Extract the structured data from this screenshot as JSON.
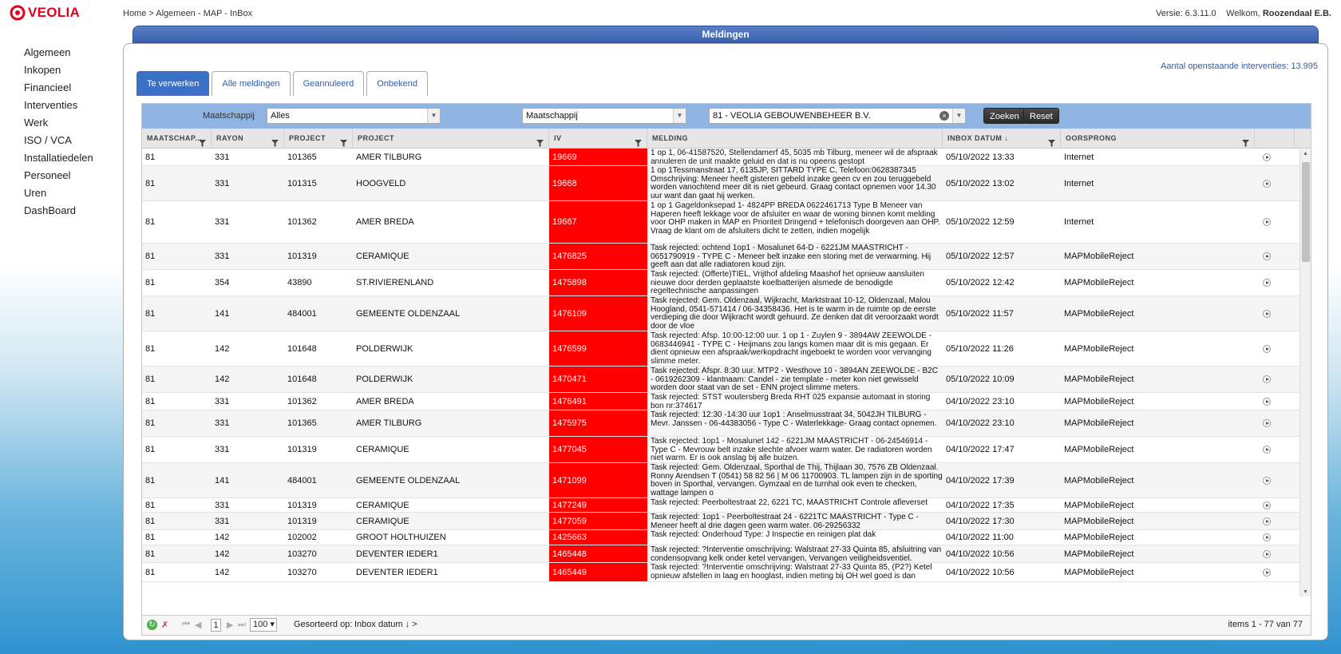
{
  "brand": {
    "name": "VEOLIA",
    "color": "#e2001a"
  },
  "breadcrumb": "Home > Algemeen - MAP - InBox",
  "version": "Versie: 6.3.11.0",
  "welcome": {
    "prefix": "Welkom,",
    "user": "Roozendaal E.B."
  },
  "sidebar": {
    "items": [
      "Algemeen",
      "Inkopen",
      "Financieel",
      "Interventies",
      "Werk",
      "ISO / VCA",
      "Installatiedelen",
      "Personeel",
      "Uren",
      "DashBoard"
    ]
  },
  "panel": {
    "title": "Meldingen",
    "open_count": "Aantal openstaande interventies: 13.995"
  },
  "tabs": [
    "Te verwerken",
    "Alle meldingen",
    "Geannuleerd",
    "Onbekend"
  ],
  "filters": {
    "label": "Maatschappij",
    "select1": "Alles",
    "select2": "Maatschappij",
    "select3": "81 - VEOLIA GEBOUWENBEHEER B.V.",
    "search_btn": "Zoeken",
    "reset_btn": "Reset"
  },
  "columns": [
    "MAATSCHAP...",
    "RAYON",
    "PROJECT",
    "PROJECT",
    "IV",
    "MELDING",
    "INBOX DATUM ↓",
    "OORSPRONG",
    ""
  ],
  "rows": [
    {
      "m": "81",
      "r": "331",
      "p": "101365",
      "n": "AMER TILBURG",
      "iv": "19669",
      "msg": "1 op 1, 06-41587520, Stellendamerf 45, 5035 mb Tilburg, meneer wil de afspraak annuleren de unit maakte geluid en dat is nu opeens gestopt",
      "d": "05/10/2022 13:33",
      "o": "Internet"
    },
    {
      "m": "81",
      "r": "331",
      "p": "101315",
      "n": "HOOGVELD",
      "iv": "19668",
      "msg": "1 op 1Tessmanstraat 17, 6135JP, SITTARD TYPE C, Telefoon:0628387345 Omschrijving: Meneer heeft gisteren gebeld inzake geen cv en zou teruggebeld worden vanochtend meer dit is niet gebeurd. Graag contact opnemen voor 14.30 uur want dan gaat hij werken.",
      "d": "05/10/2022 13:02",
      "o": "Internet"
    },
    {
      "m": "81",
      "r": "331",
      "p": "101362",
      "n": "AMER BREDA",
      "iv": "19667",
      "msg": "1 op 1 Gageldonksepad 1- 4824PP BREDA 0622461713 Type B Meneer van Haperen heeft lekkage voor de afsluiter en waar de woning binnen komt melding voor OHP maken in MAP en Prioriteit Dringend + telefonisch doorgeven aan OHP. Vraag de klant om de afsluiters dicht te zetten, indien mogelijk",
      "d": "05/10/2022 12:59",
      "o": "Internet"
    },
    {
      "m": "81",
      "r": "331",
      "p": "101319",
      "n": "CERAMIQUE",
      "iv": "1476825",
      "msg": "Task rejected: ochtend 1op1 - Mosalunet 64-D - 6221JM MAASTRICHT - 0651790919 - TYPE C - Meneer belt inzake een storing met de verwarming. Hij geeft aan dat alle radiatoren koud zijn.",
      "d": "05/10/2022 12:57",
      "o": "MAPMobileReject"
    },
    {
      "m": "81",
      "r": "354",
      "p": "43890",
      "n": "ST.RIVIERENLAND",
      "iv": "1475898",
      "msg": "Task rejected: (Offerte)TIEL, Vrijthof afdeling Maashof het opnieuw aansluiten nieuwe door derden geplaatste koelbatterijen alsmede de benodigde regeltechnische aanpassingen",
      "d": "05/10/2022 12:42",
      "o": "MAPMobileReject"
    },
    {
      "m": "81",
      "r": "141",
      "p": "484001",
      "n": "GEMEENTE OLDENZAAL",
      "iv": "1476109",
      "msg": "Task rejected: Gem. Oldenzaal, Wijkracht, Marktstraat 10-12, Oldenzaal, Malou Hoogland, 0541-571414 / 06-34358436. Het is te warm in de ruimte op de eerste verdieping die door Wijkracht wordt gehuurd. Ze denken dat dit veroorzaakt wordt door de vloe",
      "d": "05/10/2022 11:57",
      "o": "MAPMobileReject"
    },
    {
      "m": "81",
      "r": "142",
      "p": "101648",
      "n": "POLDERWIJK",
      "iv": "1476599",
      "msg": "Task rejected: Afsp. 10:00-12:00 uur. 1 op 1 - Zuylen 9 - 3894AW ZEEWOLDE - 0683446941 - TYPE C - Heijmans zou langs komen maar dit is mis gegaan. Er dient opnieuw een afspraak/werkopdracht ingeboekt te worden voor vervanging slimme meter.",
      "d": "05/10/2022 11:26",
      "o": "MAPMobileReject"
    },
    {
      "m": "81",
      "r": "142",
      "p": "101648",
      "n": "POLDERWIJK",
      "iv": "1470471",
      "msg": "Task rejected: Afspr. 8:30 uur. MTP2 - Westhove 10 - 3894AN ZEEWOLDE - B2C - 0619262309 - klantnaam: Candel - zie template - meter kon niet gewisseld worden door staat van de set - ENN project slimme meters.",
      "d": "05/10/2022 10:09",
      "o": "MAPMobileReject"
    },
    {
      "m": "81",
      "r": "331",
      "p": "101362",
      "n": "AMER BREDA",
      "iv": "1476491",
      "msg": "Task rejected: STST woutersberg Breda RHT 025 expansie automaat in storing bon nr:374617",
      "d": "04/10/2022 23:10",
      "o": "MAPMobileReject"
    },
    {
      "m": "81",
      "r": "331",
      "p": "101365",
      "n": "AMER TILBURG",
      "iv": "1475975",
      "msg": "Task rejected: 12:30 -14:30 uur 1op1 : Anselmusstraat 34, 5042JH TILBURG - Mevr. Janssen - 06-44383056 - Type C - Waterlekkage- Graag contact opnemen.",
      "d": "04/10/2022 23:10",
      "o": "MAPMobileReject"
    },
    {
      "m": "81",
      "r": "331",
      "p": "101319",
      "n": "CERAMIQUE",
      "iv": "1477045",
      "msg": "Task rejected: 1op1 - Mosalunet 142 - 6221JM MAASTRICHT - 06-24546914 - Type C - Mevrouw belt inzake slechte afvoer warm water. De radiatoren worden niet warm. Er is ook anslag bij alle buizen.",
      "d": "04/10/2022 17:47",
      "o": "MAPMobileReject"
    },
    {
      "m": "81",
      "r": "141",
      "p": "484001",
      "n": "GEMEENTE OLDENZAAL",
      "iv": "1471099",
      "msg": "Task rejected: Gem. Oldenzaal, Sporthal de Thij, Thijlaan 30, 7576 ZB Oldenzaal. Ronny Arendsen T (0541) 58 82 56 | M 06 11700903. TL lampen zijn in de sporting boven in Sporthal, vervangen. Gymzaal en de turnhal ook even te checken, wattage lampen o",
      "d": "04/10/2022 17:39",
      "o": "MAPMobileReject"
    },
    {
      "m": "81",
      "r": "331",
      "p": "101319",
      "n": "CERAMIQUE",
      "iv": "1477249",
      "msg": "Task rejected: Peerboltestraat 22, 6221 TC, MAASTRICHT Controle afleverset",
      "d": "04/10/2022 17:35",
      "o": "MAPMobileReject"
    },
    {
      "m": "81",
      "r": "331",
      "p": "101319",
      "n": "CERAMIQUE",
      "iv": "1477059",
      "msg": "Task rejected: 1op1 - Peerboltestraat 24 - 6221TC MAASTRICHT - Type C - Meneer heeft al drie dagen geen warm water. 06-29256332",
      "d": "04/10/2022 17:30",
      "o": "MAPMobileReject"
    },
    {
      "m": "81",
      "r": "142",
      "p": "102002",
      "n": "GROOT HOLTHUIZEN",
      "iv": "1425663",
      "msg": "Task rejected: Onderhoud Type: J Inspectie en reinigen plat dak",
      "d": "04/10/2022 11:00",
      "o": "MAPMobileReject"
    },
    {
      "m": "81",
      "r": "142",
      "p": "103270",
      "n": "DEVENTER IEDER1",
      "iv": "1465448",
      "msg": "Task rejected: ?Interventie omschrijving: Walstraat 27-33 Quinta 85, afsluitring van condensopvang kelk onder ketel vervangen, Vervangen veiligheidsventiel.",
      "d": "04/10/2022 10:56",
      "o": "MAPMobileReject"
    },
    {
      "m": "81",
      "r": "142",
      "p": "103270",
      "n": "DEVENTER IEDER1",
      "iv": "1465449",
      "msg": "Task rejected: ?Interventie omschrijving: Walstraat 27-33 Quinta 85, (P2?) Ketel opnieuw afstellen in laag en hooglast, indien meting bij OH wel goed is dan",
      "d": "04/10/2022 10:56",
      "o": "MAPMobileReject"
    }
  ],
  "pager": {
    "page": "1",
    "page_size": "100",
    "sort_label": "Gesorteerd op:",
    "sort_value": "Inbox datum ↓ >",
    "items": "items 1 - 77 van 77"
  }
}
